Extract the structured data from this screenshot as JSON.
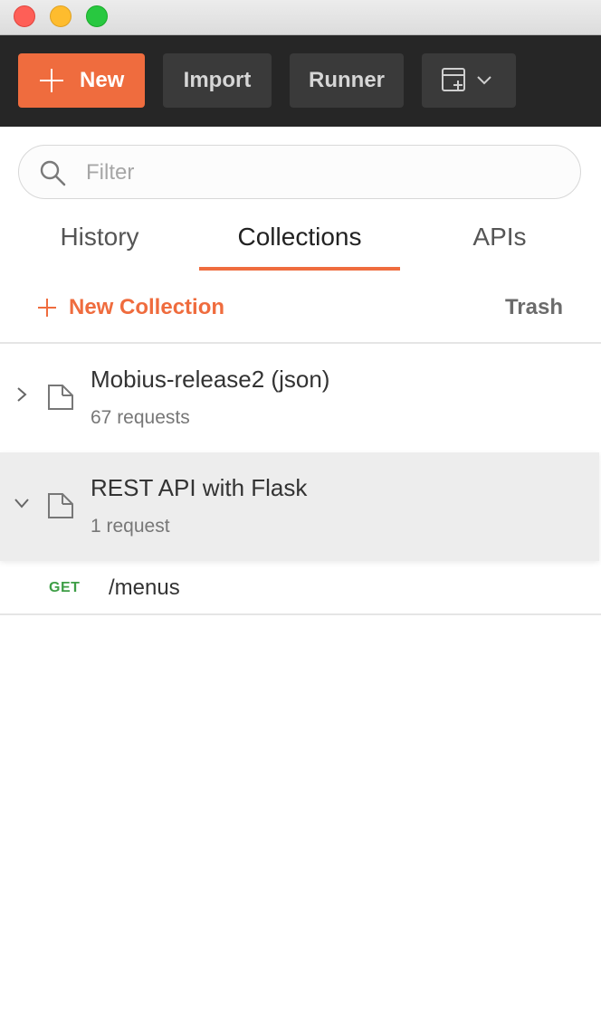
{
  "toolbar": {
    "new_label": "New",
    "import_label": "Import",
    "runner_label": "Runner"
  },
  "search": {
    "placeholder": "Filter"
  },
  "tabs": [
    {
      "label": "History",
      "active": false
    },
    {
      "label": "Collections",
      "active": true
    },
    {
      "label": "APIs",
      "active": false
    }
  ],
  "actions": {
    "new_collection_label": "New Collection",
    "trash_label": "Trash"
  },
  "collections": [
    {
      "name": "Mobius-release2 (json)",
      "count": "67 requests",
      "expanded": false
    },
    {
      "name": "REST API with Flask",
      "count": "1 request",
      "expanded": true
    }
  ],
  "requests": [
    {
      "method": "GET",
      "path": "/menus"
    }
  ],
  "colors": {
    "accent": "#ef6c3e",
    "toolbar_bg": "#262626",
    "method_get": "#3e9e46"
  },
  "icons": {
    "search": "search-icon",
    "folder": "folder-icon",
    "chevron_right": "chevron-right-icon",
    "chevron_down": "chevron-down-icon",
    "new_window": "new-window-icon"
  }
}
